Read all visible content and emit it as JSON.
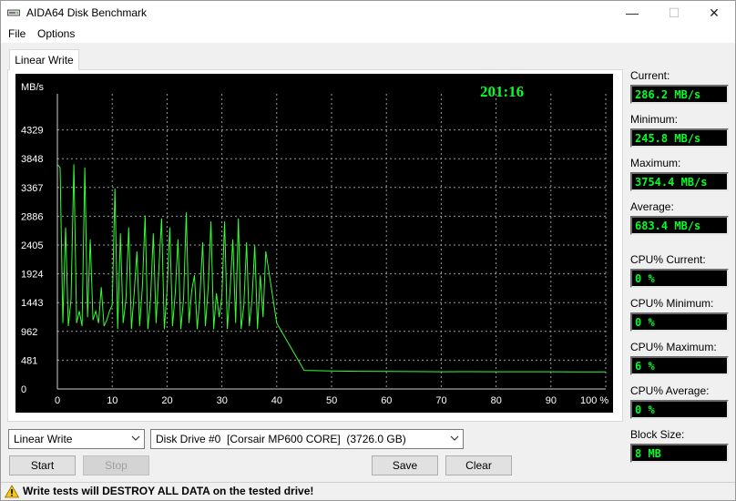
{
  "window": {
    "title": "AIDA64 Disk Benchmark",
    "minimize_glyph": "—",
    "maximize_glyph": "☐",
    "close_glyph": "✕"
  },
  "menu": {
    "file": "File",
    "options": "Options"
  },
  "tab": {
    "label": "Linear Write"
  },
  "stats": {
    "current_label": "Current:",
    "current_value": "286.2 MB/s",
    "minimum_label": "Minimum:",
    "minimum_value": "245.8 MB/s",
    "maximum_label": "Maximum:",
    "maximum_value": "3754.4 MB/s",
    "average_label": "Average:",
    "average_value": "683.4 MB/s",
    "cpu_current_label": "CPU% Current:",
    "cpu_current_value": "0 %",
    "cpu_minimum_label": "CPU% Minimum:",
    "cpu_minimum_value": "0 %",
    "cpu_maximum_label": "CPU% Maximum:",
    "cpu_maximum_value": "6 %",
    "cpu_average_label": "CPU% Average:",
    "cpu_average_value": "0 %",
    "block_size_label": "Block Size:",
    "block_size_value": "8 MB"
  },
  "controls": {
    "test_select": "Linear Write",
    "drive_select": "Disk Drive #0  [Corsair MP600 CORE]  (3726.0 GB)",
    "start_label": "Start",
    "stop_label": "Stop",
    "save_label": "Save",
    "clear_label": "Clear"
  },
  "status": {
    "warning": "Write tests will DESTROY ALL DATA on the tested drive!"
  },
  "colors": {
    "plot_bg": "#000000",
    "line": "#33ff33",
    "grid": "#9a9a9a",
    "axis_text": "#ffffff",
    "timer": "#00ff28"
  },
  "chart_data": {
    "type": "line",
    "title": "",
    "timer": "201:16",
    "ylabel": "MB/s",
    "y_ticks": [
      0,
      481,
      962,
      1443,
      1924,
      2405,
      2886,
      3367,
      3848,
      4329
    ],
    "x_ticks": [
      "0",
      "10",
      "20",
      "30",
      "40",
      "50",
      "60",
      "70",
      "80",
      "90",
      "100 %"
    ],
    "xlim": [
      0,
      100
    ],
    "ylim": [
      0,
      4810
    ],
    "grid": true,
    "series": [
      {
        "x": [
          0,
          0.5,
          1,
          1.5,
          2,
          2.5,
          3,
          3.5,
          4,
          4.5,
          5,
          5.5,
          6,
          6.5,
          7,
          7.5,
          8,
          8.5,
          9,
          9.5,
          10,
          10.5,
          11,
          11.5,
          12,
          12.5,
          13,
          13.5,
          14,
          14.5,
          15,
          15.5,
          16,
          16.5,
          17,
          17.5,
          18,
          18.5,
          19,
          19.5,
          20,
          20.5,
          21,
          21.5,
          22,
          22.5,
          23,
          23.5,
          24,
          24.5,
          25,
          25.5,
          26,
          26.5,
          27,
          27.5,
          28,
          28.5,
          29,
          29.5,
          30,
          30.5,
          31,
          31.5,
          32,
          32.5,
          33,
          33.5,
          34,
          34.5,
          35,
          35.5,
          36,
          36.5,
          37,
          37.5,
          38,
          40,
          45,
          50,
          55,
          60,
          65,
          70,
          75,
          80,
          85,
          90,
          95,
          100
        ],
        "y": [
          3750,
          3700,
          1100,
          2700,
          1050,
          1500,
          3754,
          1100,
          1300,
          1050,
          3700,
          1200,
          2500,
          1150,
          1300,
          1100,
          1700,
          1050,
          1150,
          1300,
          1400,
          3350,
          1000,
          2600,
          1100,
          1500,
          2700,
          1000,
          1600,
          2300,
          1050,
          1700,
          2900,
          1000,
          1500,
          2600,
          1100,
          2000,
          2850,
          1000,
          1650,
          2700,
          1050,
          1600,
          2500,
          1000,
          1500,
          2950,
          1100,
          1650,
          1900,
          1000,
          1550,
          2450,
          1050,
          1700,
          2800,
          1000,
          1600,
          1200,
          1550,
          2800,
          1000,
          1650,
          2500,
          1100,
          2850,
          1000,
          1400,
          2450,
          1050,
          1500,
          2400,
          1000,
          1900,
          1200,
          2300,
          1100,
          310,
          300,
          295,
          292,
          290,
          288,
          289,
          287,
          288,
          287,
          286,
          286.2
        ]
      }
    ]
  }
}
